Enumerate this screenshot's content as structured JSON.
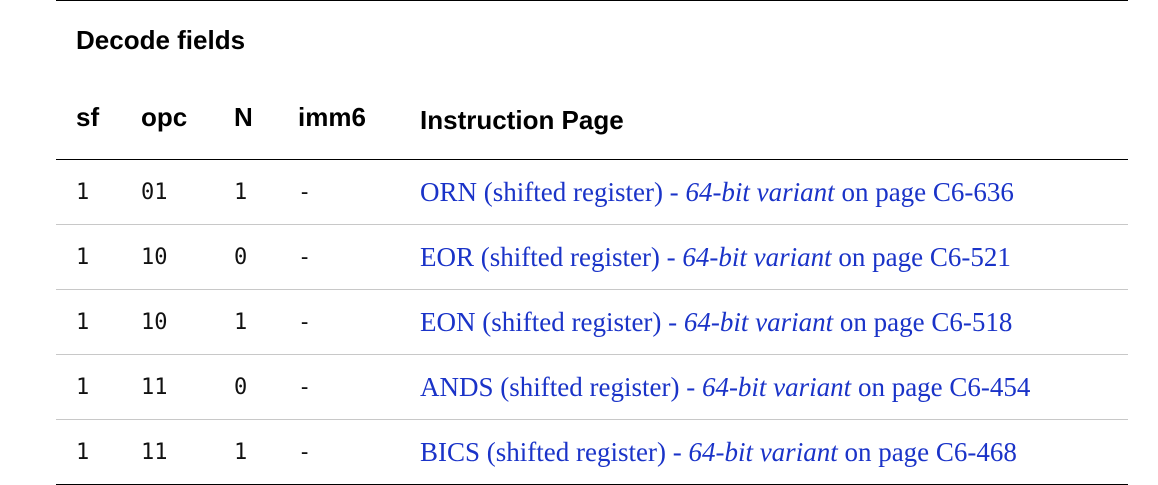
{
  "table": {
    "headers": {
      "group_label": "Decode fields",
      "instruction_page": "Instruction Page",
      "sf": "sf",
      "opc": "opc",
      "n": "N",
      "imm6": "imm6"
    },
    "rows": [
      {
        "sf": "1",
        "opc": "01",
        "n": "1",
        "imm6": "-",
        "link_prefix": "ORN (shifted register) - ",
        "variant": "64-bit variant",
        "link_suffix": " on page C6-636"
      },
      {
        "sf": "1",
        "opc": "10",
        "n": "0",
        "imm6": "-",
        "link_prefix": "EOR (shifted register) - ",
        "variant": "64-bit variant",
        "link_suffix": " on page C6-521"
      },
      {
        "sf": "1",
        "opc": "10",
        "n": "1",
        "imm6": "-",
        "link_prefix": "EON (shifted register) - ",
        "variant": "64-bit variant",
        "link_suffix": " on page C6-518"
      },
      {
        "sf": "1",
        "opc": "11",
        "n": "0",
        "imm6": "-",
        "link_prefix": "ANDS (shifted register) - ",
        "variant": "64-bit variant",
        "link_suffix": " on page C6-454"
      },
      {
        "sf": "1",
        "opc": "11",
        "n": "1",
        "imm6": "-",
        "link_prefix": "BICS (shifted register) - ",
        "variant": "64-bit variant",
        "link_suffix": " on page C6-468"
      }
    ]
  },
  "colors": {
    "link": "#1a33c8",
    "text": "#000000",
    "row_divider": "#c8c8c8"
  }
}
